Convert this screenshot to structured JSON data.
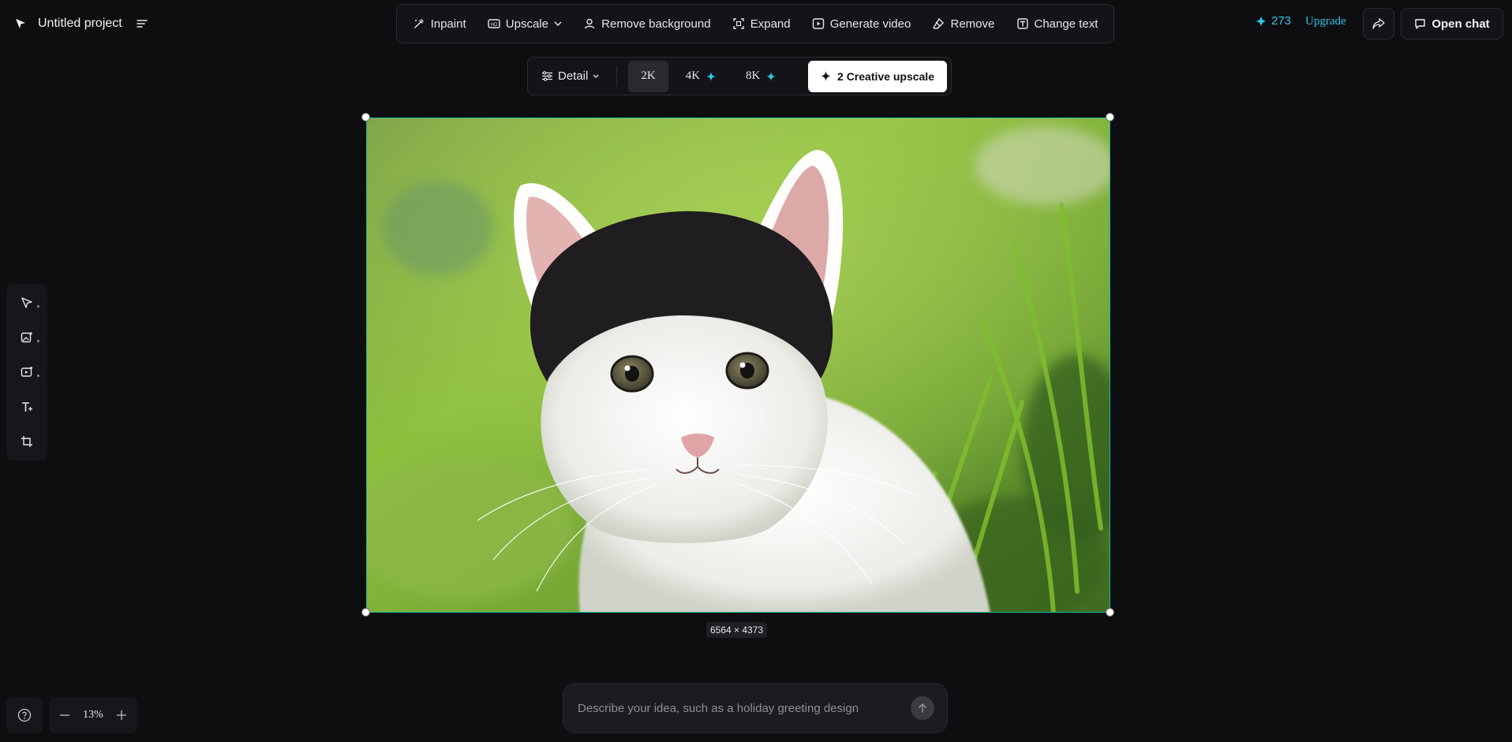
{
  "project": {
    "title": "Untitled project"
  },
  "toolbar": {
    "inpaint": "Inpaint",
    "upscale": "Upscale",
    "remove_background": "Remove background",
    "expand": "Expand",
    "generate_video": "Generate video",
    "remove": "Remove",
    "change_text": "Change text"
  },
  "account": {
    "credits": "273",
    "upgrade": "Upgrade",
    "open_chat": "Open chat"
  },
  "upscale_bar": {
    "detail": "Detail",
    "options": [
      "2K",
      "4K",
      "8K"
    ],
    "active_option": "2K",
    "creative_label": "2 Creative upscale"
  },
  "canvas": {
    "dimensions": "6564 × 4373"
  },
  "zoom": {
    "level": "13%"
  },
  "prompt": {
    "placeholder": "Describe your idea, such as a holiday greeting design"
  },
  "icons": {
    "left_rail": [
      "select-cursor-icon",
      "add-image-icon",
      "add-video-icon",
      "add-text-icon",
      "crop-frame-icon"
    ]
  },
  "colors": {
    "accent": "#2ec6e8",
    "selection": "#1fb39a",
    "background": "#0e0e11"
  }
}
